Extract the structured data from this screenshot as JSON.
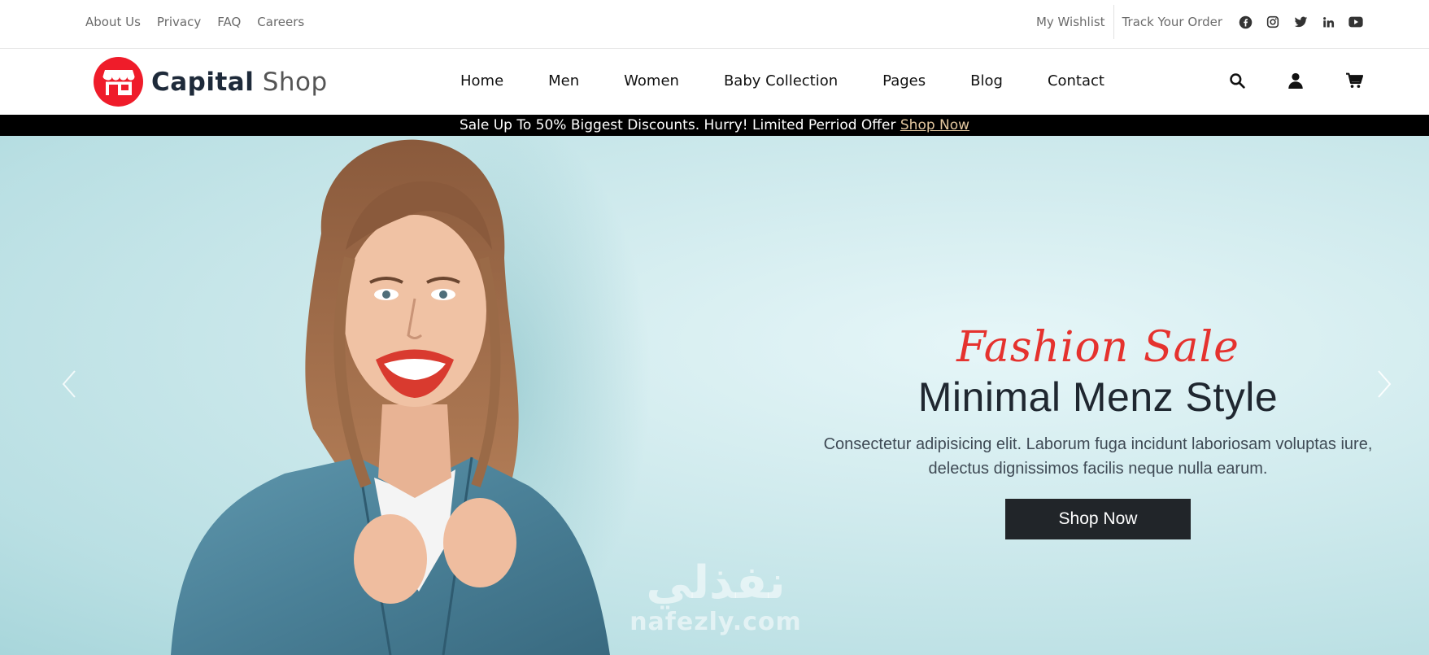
{
  "topbar": {
    "links": [
      "About Us",
      "Privacy",
      "FAQ",
      "Careers"
    ],
    "wishlist": "My Wishlist",
    "track_order": "Track Your Order",
    "social_icons": [
      "facebook-icon",
      "instagram-icon",
      "twitter-icon",
      "linkedin-icon",
      "youtube-icon"
    ]
  },
  "header": {
    "brand_bold": "Capital",
    "brand_light": "Shop",
    "nav": [
      "Home",
      "Men",
      "Women",
      "Baby Collection",
      "Pages",
      "Blog",
      "Contact"
    ],
    "icons": [
      "search-icon",
      "user-icon",
      "cart-icon"
    ]
  },
  "promo": {
    "text": "Sale Up To 50% Biggest Discounts. Hurry! Limited Perriod Offer",
    "link": "Shop Now"
  },
  "hero": {
    "script_title": "Fashion Sale",
    "headline": "Minimal Menz Style",
    "description": "Consectetur adipisicing elit. Laborum fuga incidunt laboriosam voluptas iure, delectus dignissimos facilis neque nulla earum.",
    "cta": "Shop Now",
    "watermark_ar": "نفذلي",
    "watermark_en": "nafezly.com"
  },
  "colors": {
    "brand_red": "#ef1c2a",
    "promo_bg": "#000000",
    "promo_link": "#e3c79f",
    "script_red": "#e5322e",
    "cta_bg": "#212529",
    "hero_bg": "#cde9ec"
  }
}
